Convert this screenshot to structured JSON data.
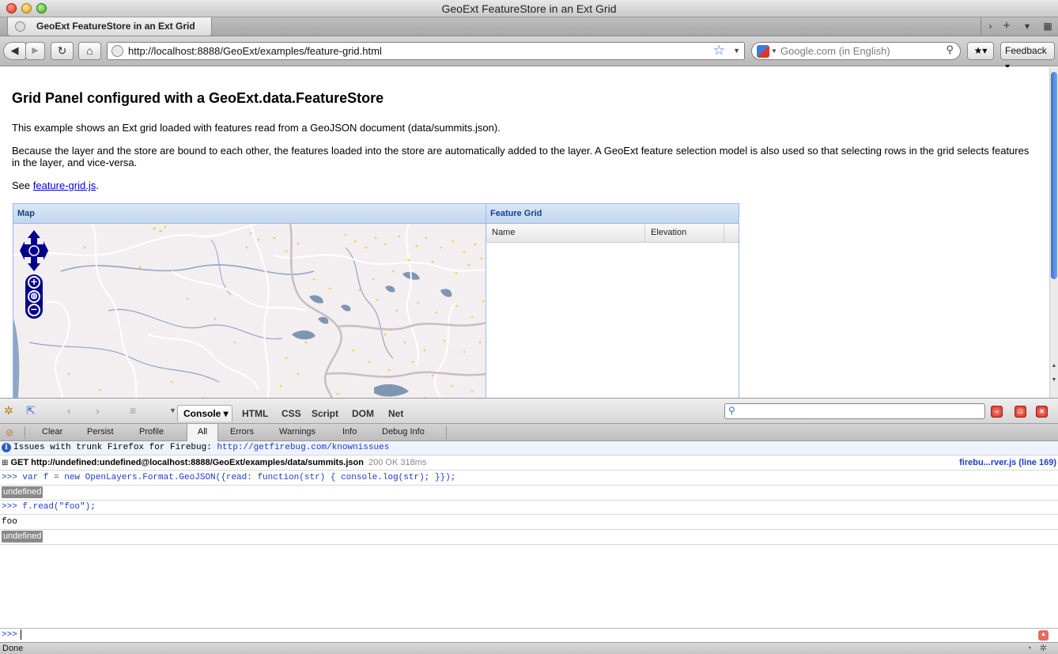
{
  "window": {
    "title": "GeoExt FeatureStore in an Ext Grid",
    "tab_title": "GeoExt FeatureStore in an Ext Grid"
  },
  "toolbar": {
    "url": "http://localhost:8888/GeoExt/examples/feature-grid.html",
    "search_placeholder": "Google.com (in English)",
    "feedback_label": "Feedback ▾"
  },
  "page": {
    "heading": "Grid Panel configured with a GeoExt.data.FeatureStore",
    "para1": "This example shows an Ext grid loaded with features read from a GeoJSON document (data/summits.json).",
    "para2": "Because the layer and the store are bound to each other, the features loaded into the store are automatically added to the layer. A GeoExt feature selection model is also used so that selecting rows in the grid selects features in the layer, and vice-versa.",
    "para3_prefix": "See ",
    "para3_link": "feature-grid.js",
    "para3_suffix": ".",
    "map_panel_title": "Map",
    "grid_panel_title": "Feature Grid",
    "grid_columns": [
      "Name",
      "Elevation"
    ]
  },
  "firebug": {
    "console_tab": "Console ▾",
    "tabs": [
      "HTML",
      "CSS",
      "Script",
      "DOM",
      "Net"
    ],
    "commands": [
      "Clear",
      "Persist",
      "Profile"
    ],
    "filters": [
      "All",
      "Errors",
      "Warnings",
      "Info",
      "Debug Info"
    ],
    "info_text": "Issues with trunk Firefox for Firebug: ",
    "info_link": "http://getfirebug.com/knownissues",
    "get_request": "GET http://undefined:undefined@localhost:8888/GeoExt/examples/data/summits.json",
    "get_status": "200 OK 318ms",
    "get_source": "firebu...rver.js (line 169)",
    "cmd1": ">>> var f = new OpenLayers.Format.GeoJSON({read: function(str) { console.log(str); }});",
    "result1": "undefined",
    "cmd2": ">>> f.read(\"foo\");",
    "output2": "foo",
    "result2": "undefined",
    "prompt": ">>>"
  },
  "status": {
    "text": "Done"
  },
  "colors": {
    "ext_header_text": "#15428b",
    "ext_border": "#99bbe8",
    "map_background": "#f3eef0",
    "zoom_control": "#00008b",
    "firebug_link": "#1b3cd0"
  }
}
